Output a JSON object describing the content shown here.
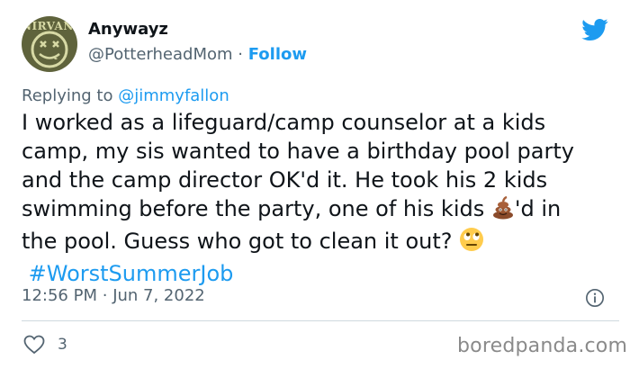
{
  "user": {
    "display_name": "Anywayz",
    "handle": "@PotterheadMom",
    "separator": "·",
    "follow_label": "Follow",
    "avatar_logo_text": "NIRVANA"
  },
  "reply": {
    "prefix": "Replying to",
    "mention": "@jimmyfallon"
  },
  "tweet": {
    "lines": [
      "I worked as a lifeguard/camp counselor at a kids",
      "camp, my sis wanted to have a birthday pool party",
      "and the camp director OK'd it. He took his 2 kids"
    ],
    "line4_before_emoji": "swimming before the party, one of his kids ",
    "line4_after_emoji": "'d in",
    "line5": "the pool. Guess who got to clean it out? ",
    "hashtag": "#WorstSummerJob"
  },
  "meta": {
    "time": "12:56 PM",
    "separator": "·",
    "date": "Jun 7, 2022"
  },
  "engagement": {
    "likes": "3"
  },
  "watermark": "boredpanda.com",
  "colors": {
    "accent": "#1d9bf0",
    "secondary_text": "#536471",
    "divider": "#cfd9de"
  },
  "icons": [
    "twitter-bird-icon",
    "poop-emoji-icon",
    "eye-roll-emoji-icon",
    "info-icon",
    "heart-icon"
  ]
}
